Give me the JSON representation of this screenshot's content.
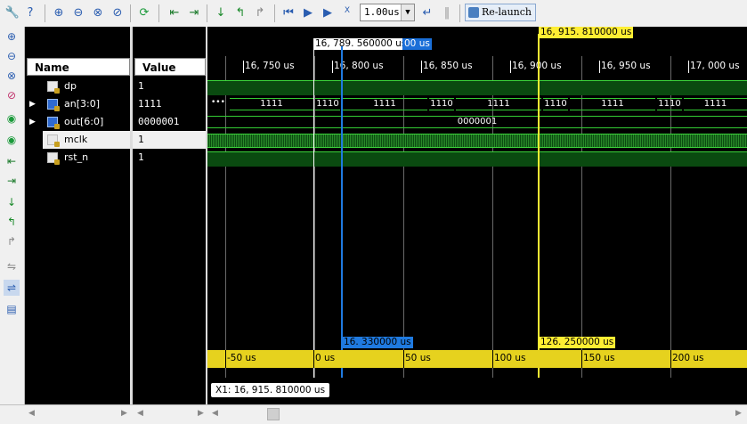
{
  "toolbar": {
    "time_value": "1.00us",
    "relaunch_label": "Re-launch"
  },
  "columns": {
    "name_header": "Name",
    "value_header": "Value"
  },
  "signals": [
    {
      "name": "dp",
      "value": "1"
    },
    {
      "name": "an[3:0]",
      "value": "1111"
    },
    {
      "name": "out[6:0]",
      "value": "0000001"
    },
    {
      "name": "mclk",
      "value": "1"
    },
    {
      "name": "rst_n",
      "value": "1"
    }
  ],
  "ruler": {
    "ticks": [
      "16, 750 us",
      "16, 800 us",
      "16, 850 us",
      "16, 900 us",
      "16, 950 us",
      "17, 000 us"
    ]
  },
  "cursors": {
    "white_label": "16, 789. 560000 us",
    "blue_label": "00 us",
    "yellow_label": "16, 915. 810000 us",
    "blue_delta": "16. 330000 us",
    "yellow_delta": "126. 250000 us"
  },
  "an_segments": [
    "1111",
    "1110",
    "1111",
    "1110",
    "1111",
    "1110",
    "1111",
    "1110",
    "1111"
  ],
  "out_value": "0000001",
  "delta_ruler": {
    "ticks": [
      "-50 us",
      "0 us",
      "50 us",
      "100 us",
      "150 us",
      "200 us"
    ]
  },
  "readout": "X1: 16, 915. 810000 us"
}
